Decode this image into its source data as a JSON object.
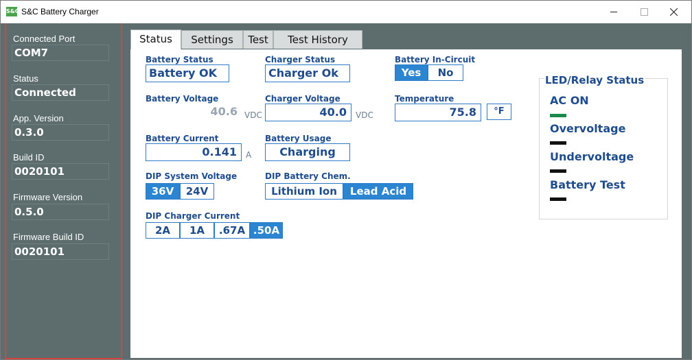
{
  "window": {
    "title": "S&C Battery Charger",
    "icon_text": "S&C"
  },
  "sidebar": {
    "fields": [
      {
        "label": "Connected Port",
        "value": "COM7"
      },
      {
        "label": "Status",
        "value": "Connected"
      },
      {
        "label": "App. Version",
        "value": "0.3.0"
      },
      {
        "label": "Build ID",
        "value": "0020101"
      },
      {
        "label": "Firmware Version",
        "value": "0.5.0"
      },
      {
        "label": "Firmware Build ID",
        "value": "0020101"
      }
    ]
  },
  "tabs": [
    "Status",
    "Settings",
    "Test",
    "Test History"
  ],
  "active_tab": "Status",
  "status": {
    "battery_status": {
      "label": "Battery Status",
      "value": "Battery OK"
    },
    "charger_status": {
      "label": "Charger Status",
      "value": "Charger Ok"
    },
    "battery_in_circuit": {
      "label": "Battery In-Circuit",
      "options": [
        "Yes",
        "No"
      ],
      "selected": "Yes"
    },
    "battery_voltage": {
      "label": "Battery Voltage",
      "value": "40.6",
      "unit": "VDC"
    },
    "charger_voltage": {
      "label": "Charger Voltage",
      "value": "40.0",
      "unit": "VDC"
    },
    "temperature": {
      "label": "Temperature",
      "value": "75.8",
      "unit_button": "°F"
    },
    "battery_current": {
      "label": "Battery Current",
      "value": "0.141",
      "unit": "A"
    },
    "battery_usage": {
      "label": "Battery Usage",
      "value": "Charging"
    },
    "dip_system_voltage": {
      "label": "DIP System Voltage",
      "options": [
        "36V",
        "24V"
      ],
      "selected": "36V"
    },
    "dip_battery_chem": {
      "label": "DIP Battery Chem.",
      "options": [
        "Lithium Ion",
        "Lead Acid"
      ],
      "selected": "Lead Acid"
    },
    "dip_charger_current": {
      "label": "DIP Charger Current",
      "options": [
        "2A",
        "1A",
        ".67A",
        ".50A"
      ],
      "selected": ".50A"
    }
  },
  "led_relay": {
    "title": "LED/Relay Status",
    "items": [
      {
        "label": "AC ON",
        "color": "#1a8a4c"
      },
      {
        "label": "Overvoltage",
        "color": "#111111"
      },
      {
        "label": "Undervoltage",
        "color": "#111111"
      },
      {
        "label": "Battery Test",
        "color": "#111111"
      }
    ]
  }
}
